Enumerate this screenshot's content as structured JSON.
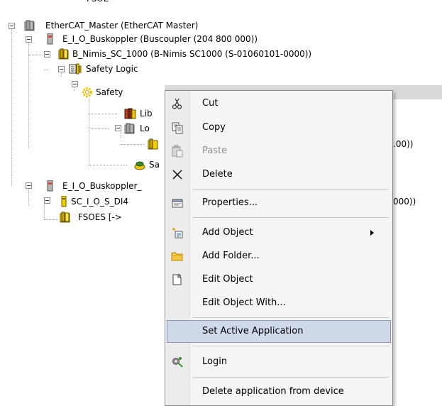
{
  "tree": {
    "top_partial": "FSOE",
    "nodes": [
      {
        "label": "EtherCAT_Master (EtherCAT Master)"
      },
      {
        "label": "E_I_O_Buskoppler (Buscoupler (204 800 000))"
      },
      {
        "label": "B_Nimis_SC_1000 (B-Nimis SC1000 (S-01060101-0000))"
      },
      {
        "label": "Safety Logic"
      },
      {
        "label": "Safety"
      },
      {
        "label": "Lib"
      },
      {
        "label": "Lo"
      },
      {
        "label": ".00))"
      },
      {
        "label": "Sa"
      },
      {
        "label": "E_I_O_Buskoppler_"
      },
      {
        "label": "SC_I_O_S_DI4"
      },
      {
        "label": "000))"
      },
      {
        "label": "FSOES [->"
      }
    ]
  },
  "context_menu": {
    "items": [
      {
        "label": "Cut",
        "icon": "scissors-icon"
      },
      {
        "label": "Copy",
        "icon": "copy-icon"
      },
      {
        "label": "Paste",
        "icon": "paste-icon",
        "disabled": true
      },
      {
        "label": "Delete",
        "icon": "delete-x-icon"
      },
      {
        "label": "Properties...",
        "icon": "properties-icon"
      },
      {
        "label": "Add Object",
        "icon": "add-object-icon",
        "submenu": true
      },
      {
        "label": "Add Folder...",
        "icon": "folder-icon"
      },
      {
        "label": "Edit Object",
        "icon": "edit-object-icon"
      },
      {
        "label": "Edit Object With..."
      },
      {
        "label": "Set Active Application"
      },
      {
        "label": "Login",
        "icon": "login-icon"
      },
      {
        "label": "Delete application from device"
      }
    ]
  }
}
